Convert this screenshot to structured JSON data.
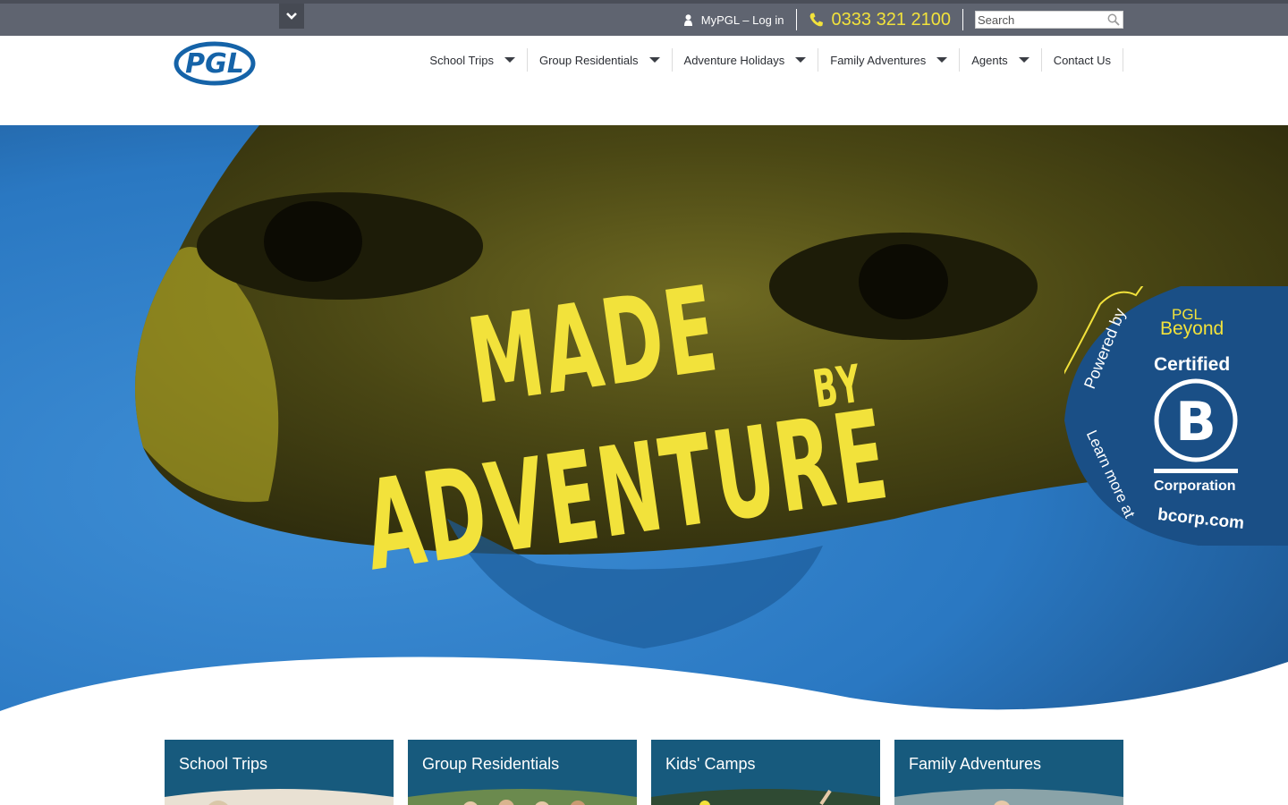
{
  "utility_bar": {
    "toggle_icon": "chevron-down-icon",
    "login_label": "MyPGL – Log in",
    "user_icon": "user-icon",
    "phone_icon": "phone-icon",
    "phone_number": "0333 321 2100",
    "search_placeholder": "Search",
    "search_icon": "search-icon"
  },
  "header": {
    "logo_text": "PGL",
    "nav": [
      {
        "label": "School Trips",
        "has_dropdown": true
      },
      {
        "label": "Group Residentials",
        "has_dropdown": true
      },
      {
        "label": "Adventure Holidays",
        "has_dropdown": true
      },
      {
        "label": "Family Adventures",
        "has_dropdown": true
      },
      {
        "label": "Agents",
        "has_dropdown": true
      },
      {
        "label": "Contact Us",
        "has_dropdown": false
      }
    ]
  },
  "hero": {
    "headline_line1": "MADE",
    "headline_by": "BY",
    "headline_line2": "ADVENTURE",
    "badge": {
      "pgl": "PGL",
      "beyond": "Beyond",
      "powered_by": "Powered by",
      "certified": "Certified",
      "corporation": "Corporation",
      "learn_more": "Learn more at",
      "url": "bcorp.com"
    }
  },
  "cards": [
    {
      "title": "School Trips"
    },
    {
      "title": "Group Residentials"
    },
    {
      "title": "Kids' Camps"
    },
    {
      "title": "Family Adventures"
    }
  ],
  "colors": {
    "utility_bg": "#5f6470",
    "accent_yellow": "#f2e23b",
    "brand_blue": "#1563a8",
    "card_blue": "#175a7d"
  }
}
